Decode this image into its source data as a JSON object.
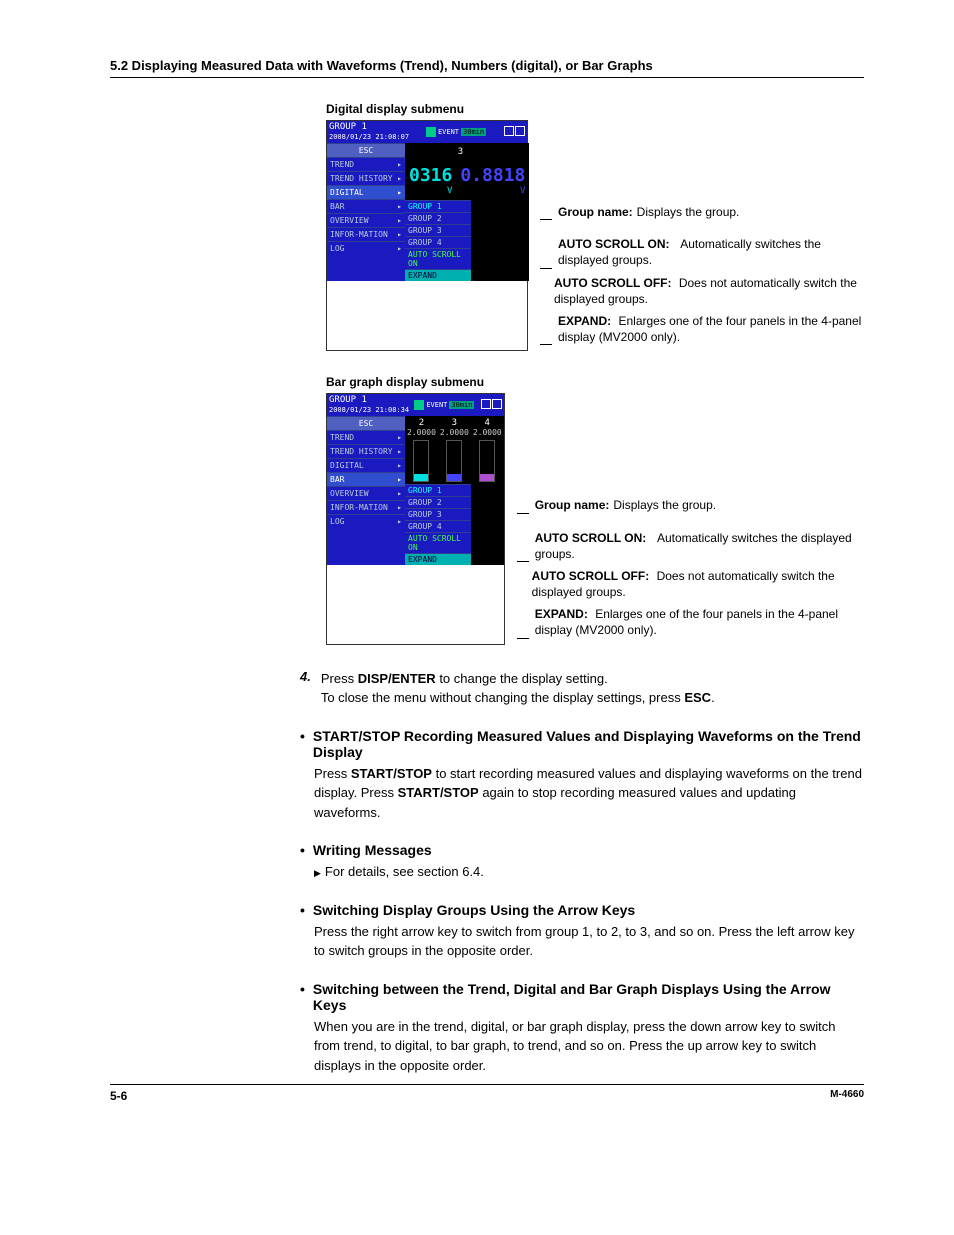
{
  "header": "5.2  Displaying Measured Data with Waveforms (Trend), Numbers (digital), or Bar Graphs",
  "fig1": {
    "title": "Digital display submenu",
    "top_left": "GROUP 1",
    "top_date": "2008/01/23 21:08:07",
    "event": "EVENT",
    "t30": "30min",
    "left_items": [
      "ESC",
      "TREND",
      "TREND HISTORY",
      "DIGITAL",
      "BAR",
      "OVERVIEW",
      "INFOR-MATION",
      "LOG"
    ],
    "sub_items": [
      "GROUP 1",
      "GROUP 2",
      "GROUP 3",
      "GROUP 4",
      "AUTO SCROLL ON",
      "EXPAND"
    ],
    "dig_head": "3",
    "dig_left_big": "0316",
    "dig_left_unit": "V",
    "dig_right_big": "0.8818",
    "dig_right_unit": "V"
  },
  "annot": [
    {
      "lbl": "Group name:",
      "txt": "Displays the group."
    },
    {
      "lbl": "AUTO SCROLL ON:",
      "txt": "Automatically switches the displayed groups."
    },
    {
      "lbl": "AUTO SCROLL OFF:",
      "txt": "Does not automatically switch the displayed groups."
    },
    {
      "lbl": "EXPAND:",
      "txt": "Enlarges one of the four panels in the 4-panel display (MV2000 only)."
    }
  ],
  "fig2": {
    "title": "Bar graph display submenu",
    "top_left": "GROUP 1",
    "top_date": "2008/01/23 21:08:34",
    "cols": [
      "2",
      "3",
      "4"
    ],
    "vals": [
      "2.0000",
      "2.0000",
      "2.0000"
    ]
  },
  "step4": {
    "num": "4.",
    "line1_a": "Press ",
    "line1_b": "DISP/ENTER",
    "line1_c": " to change the display setting.",
    "line2_a": " To close the menu without changing the display settings, press ",
    "line2_b": "ESC",
    "line2_c": "."
  },
  "b1": {
    "title": "START/STOP Recording Measured Values and Displaying Waveforms on the Trend Display",
    "p1a": "Press ",
    "p1b": "START/STOP",
    "p1c": " to start recording measured values and displaying waveforms on the trend display. Press ",
    "p1d": "START/STOP",
    "p1e": " again to stop recording measured values and updating waveforms."
  },
  "b2": {
    "title": "Writing Messages",
    "ref": "For details, see section 6.4."
  },
  "b3": {
    "title": "Switching Display Groups Using the Arrow Keys",
    "body": "Press the right arrow key to switch from group 1, to 2, to 3, and so on. Press the left arrow key to switch groups in the opposite order."
  },
  "b4": {
    "title": "Switching between the Trend, Digital and Bar Graph Displays Using the Arrow Keys",
    "body": "When you are in the trend, digital, or bar graph display, press the down arrow key to switch from trend, to digital, to bar graph, to trend, and so on. Press the up arrow key to switch displays in the opposite order."
  },
  "footer": {
    "page": "5-6",
    "doc": "M-4660"
  }
}
